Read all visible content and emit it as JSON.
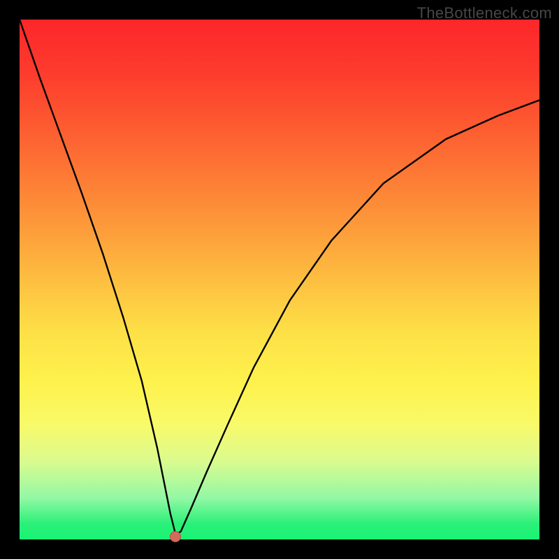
{
  "watermark": "TheBottleneck.com",
  "chart_data": {
    "type": "line",
    "title": "",
    "xlabel": "",
    "ylabel": "",
    "xlim": [
      0,
      100
    ],
    "ylim": [
      0,
      100
    ],
    "grid": false,
    "legend": false,
    "gradient_colors": {
      "top": "#fd262a",
      "mid": "#fde046",
      "bottom": "#19f375"
    },
    "series": [
      {
        "name": "curve",
        "x": [
          0,
          4,
          8,
          12,
          16,
          20,
          23.5,
          25.0,
          26.5,
          28.0,
          29.0,
          30.0,
          31.0,
          33.0,
          36.0,
          40.0,
          45.0,
          52.0,
          60.0,
          70.0,
          82.0,
          92.0,
          100.0
        ],
        "y": [
          100,
          88.5,
          77.5,
          66.5,
          55.0,
          42.5,
          30.5,
          24.0,
          17.5,
          10.0,
          5.0,
          1.0,
          1.5,
          6.0,
          13.0,
          22.0,
          33.0,
          46.0,
          57.5,
          68.5,
          77.0,
          81.5,
          84.5
        ]
      }
    ],
    "cusp_marker": {
      "x": 30.0,
      "y": 0.6,
      "color": "#d46a5a"
    }
  }
}
